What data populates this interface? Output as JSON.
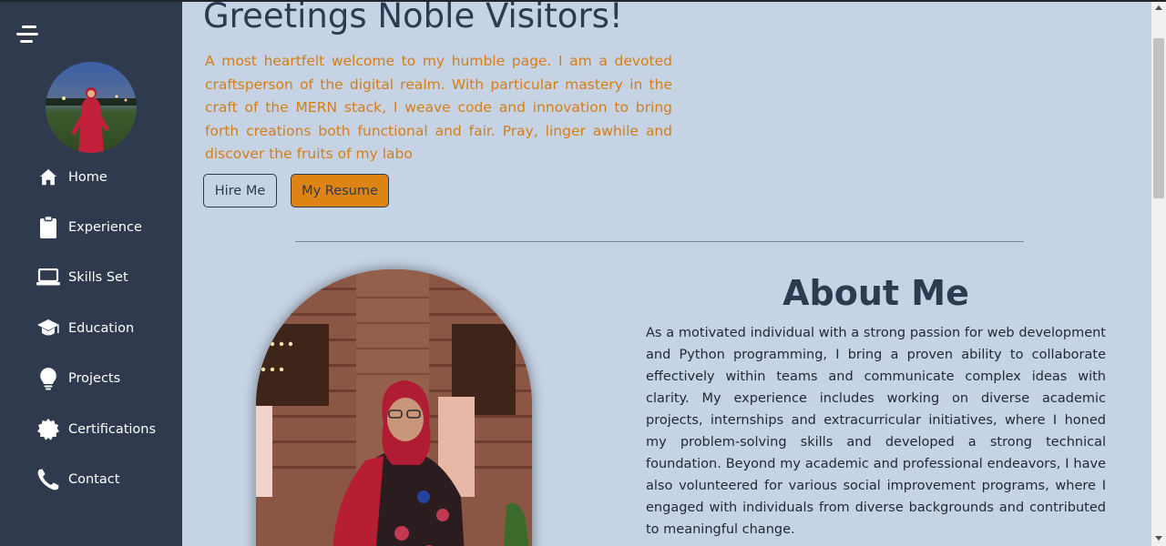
{
  "sidebar": {
    "menu_icon": "hamburger-menu-icon",
    "items": [
      {
        "label": "Home",
        "icon": "home-icon"
      },
      {
        "label": "Experience",
        "icon": "clipboard-icon"
      },
      {
        "label": "Skills Set",
        "icon": "laptop-icon"
      },
      {
        "label": "Education",
        "icon": "graduation-cap-icon"
      },
      {
        "label": "Projects",
        "icon": "lightbulb-icon"
      },
      {
        "label": "Certifications",
        "icon": "certificate-icon"
      },
      {
        "label": "Contact",
        "icon": "phone-icon"
      }
    ]
  },
  "hero": {
    "title": "Greetings Noble Visitors!",
    "text": "A most heartfelt welcome to my humble page. I am a devoted craftsperson of the digital realm. With particular mastery in the craft of the MERN stack, I weave code and innovation to bring forth creations both functional and fair. Pray, linger awhile and discover the fruits of my labo",
    "hire_label": "Hire Me",
    "resume_label": "My Resume"
  },
  "about": {
    "title": "About Me",
    "text": "As a motivated individual with a strong passion for web development and Python programming, I bring a proven ability to collaborate effectively within teams and communicate complex ideas with clarity. My experience includes working on diverse academic projects, internships and extracurricular initiatives, where I honed my problem-solving skills and developed a strong technical foundation. Beyond my academic and professional endeavors, I have also volunteered for various social improvement programs, where I engaged with individuals from diverse backgrounds and contributed to meaningful change."
  },
  "colors": {
    "sidebar_bg": "#2f3a4e",
    "page_bg": "#c5d3e5",
    "accent": "#de8415",
    "hero_text": "#d57e16",
    "heading": "#2e3a4f"
  }
}
